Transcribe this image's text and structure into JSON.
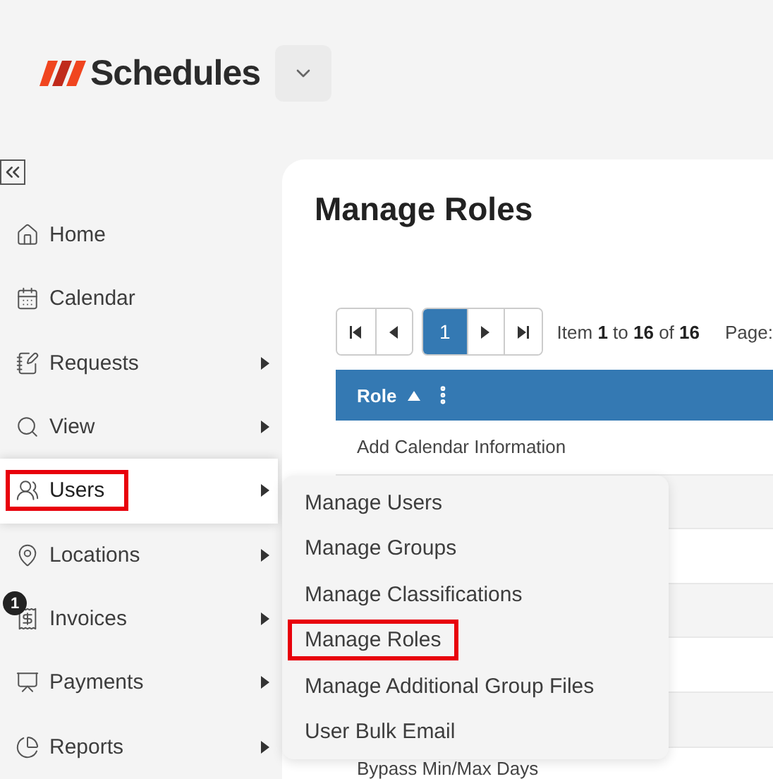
{
  "header": {
    "logo": "Schedules"
  },
  "sidebar": {
    "items": [
      {
        "label": "Home",
        "kind": "home",
        "submenu": false,
        "selected": false,
        "highlighted": false
      },
      {
        "label": "Calendar",
        "kind": "calendar",
        "submenu": false,
        "selected": false,
        "highlighted": false
      },
      {
        "label": "Requests",
        "kind": "requests",
        "submenu": true,
        "selected": false,
        "highlighted": false
      },
      {
        "label": "View",
        "kind": "search",
        "submenu": true,
        "selected": false,
        "highlighted": false
      },
      {
        "label": "Users",
        "kind": "users",
        "submenu": true,
        "selected": true,
        "highlighted": true
      },
      {
        "label": "Locations",
        "kind": "location",
        "submenu": true,
        "selected": false,
        "highlighted": false
      },
      {
        "label": "Invoices",
        "kind": "invoice",
        "submenu": true,
        "selected": false,
        "highlighted": false,
        "badge": "1"
      },
      {
        "label": "Payments",
        "kind": "payment",
        "submenu": true,
        "selected": false,
        "highlighted": false
      },
      {
        "label": "Reports",
        "kind": "reports",
        "submenu": true,
        "selected": false,
        "highlighted": false
      }
    ]
  },
  "page": {
    "title": "Manage Roles",
    "pager": {
      "pages": [
        {
          "label": "1",
          "selected": true
        }
      ],
      "summary": "Item **1** to **16** of **16**",
      "page_label": "Page:"
    },
    "table": {
      "columns": [
        {
          "label": "Role",
          "sorted_ascending": true
        }
      ],
      "rows": [
        {
          "role": "Add Calendar Information"
        },
        {
          "role": "Bypass Min/Max Days"
        }
      ]
    }
  },
  "submenu": {
    "items": [
      {
        "label": "Manage Users",
        "highlighted": false
      },
      {
        "label": "Manage Groups",
        "highlighted": false
      },
      {
        "label": "Manage Classifications",
        "highlighted": false
      },
      {
        "label": "Manage Roles",
        "highlighted": true
      },
      {
        "label": "Manage Additional Group Files",
        "highlighted": false
      },
      {
        "label": "User Bulk Email",
        "highlighted": false
      }
    ]
  }
}
